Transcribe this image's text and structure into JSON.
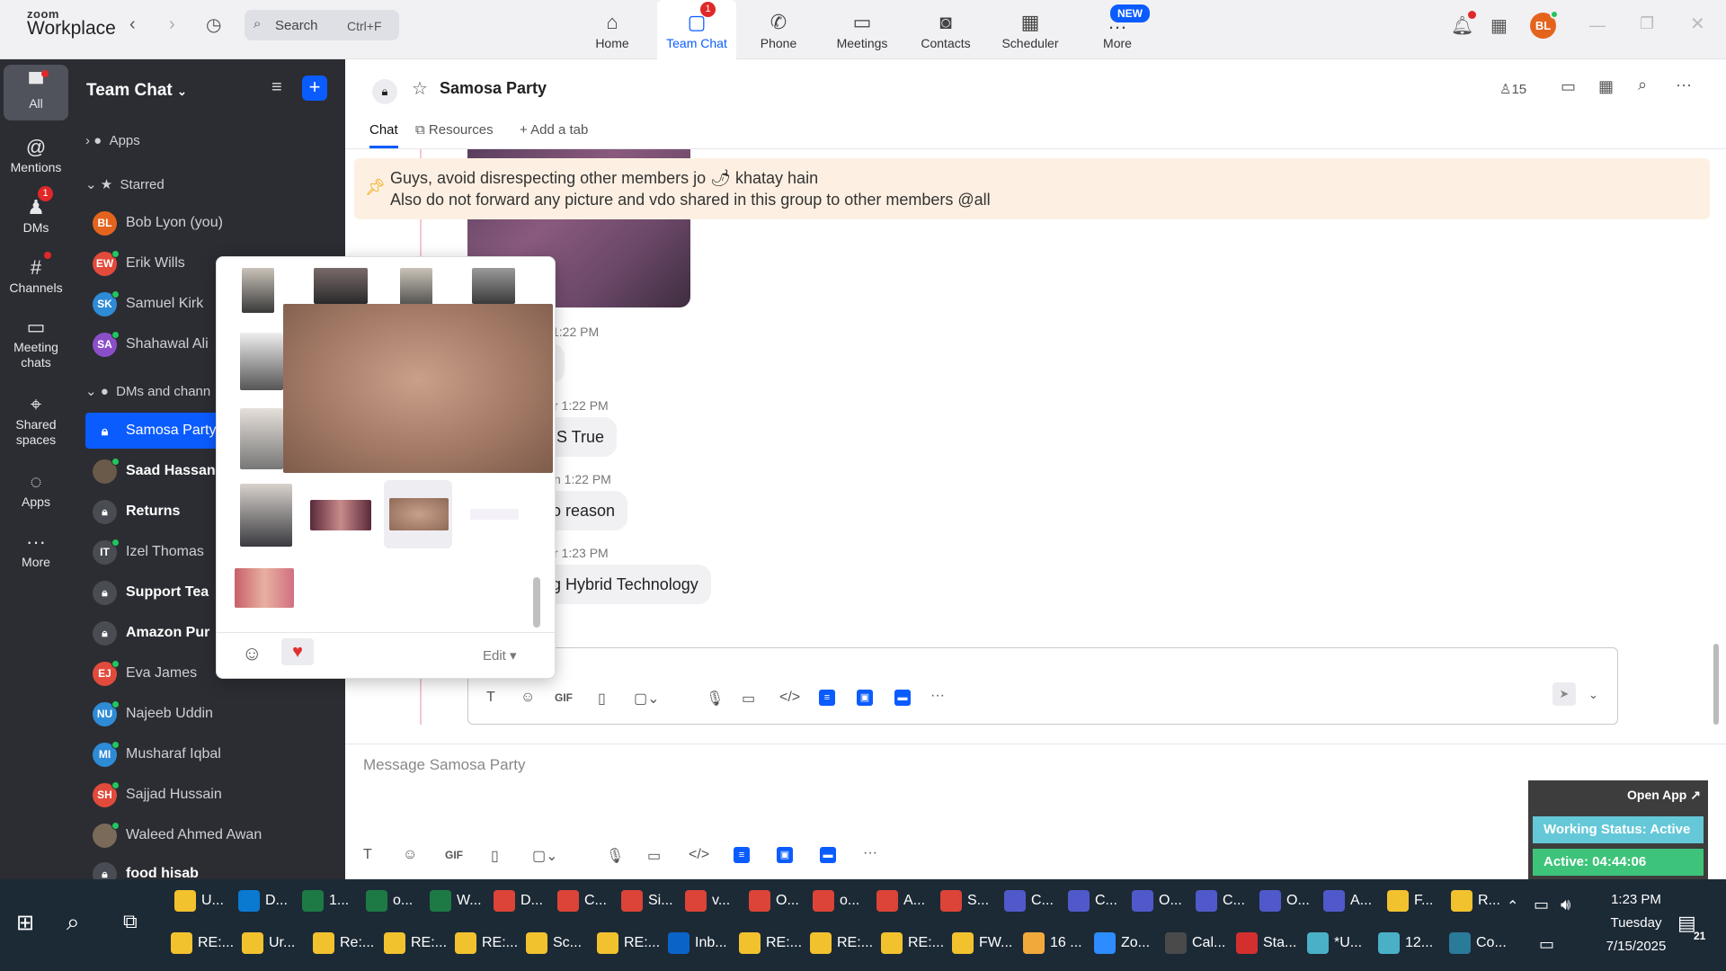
{
  "app": {
    "logo_top": "zoom",
    "logo_bottom": "Workplace"
  },
  "search": {
    "label": "Search",
    "shortcut": "Ctrl+F"
  },
  "nav": [
    {
      "label": "Home",
      "icon": "home-icon"
    },
    {
      "label": "Team Chat",
      "icon": "chat-icon",
      "badge": "1"
    },
    {
      "label": "Phone",
      "icon": "phone-icon"
    },
    {
      "label": "Meetings",
      "icon": "video-icon"
    },
    {
      "label": "Contacts",
      "icon": "contacts-icon"
    },
    {
      "label": "Scheduler",
      "icon": "calendar-icon"
    },
    {
      "label": "More",
      "icon": "more-icon",
      "badge": "NEW"
    }
  ],
  "user": {
    "initials": "BL"
  },
  "rail": [
    {
      "label": "All"
    },
    {
      "label": "Mentions"
    },
    {
      "label": "DMs",
      "badge": "1"
    },
    {
      "label": "Channels"
    },
    {
      "label": "Meeting chats"
    },
    {
      "label": "Shared spaces"
    },
    {
      "label": "Apps"
    },
    {
      "label": "More"
    }
  ],
  "sidebar": {
    "title": "Team Chat",
    "sections": {
      "apps": "Apps",
      "starred": "Starred",
      "dms": "DMs and chann"
    },
    "items": [
      {
        "initials": "BL",
        "name": "Bob Lyon (you)",
        "color": "#e4641e"
      },
      {
        "initials": "EW",
        "name": "Erik Wills",
        "color": "#e24a3b"
      },
      {
        "initials": "SK",
        "name": "Samuel Kirk",
        "color": "#2e8bd6"
      },
      {
        "initials": "SA",
        "name": "Shahawal Ali",
        "color": "#8a4fc8"
      },
      {
        "initials": "",
        "name": "Samosa Party",
        "color": "#0b5cff"
      },
      {
        "initials": "",
        "name": "Saad Hassan",
        "color": "#6a5a4a"
      },
      {
        "initials": "",
        "name": "Returns",
        "color": "#4a4c53"
      },
      {
        "initials": "IT",
        "name": "Izel Thomas",
        "color": "#4a4c53"
      },
      {
        "initials": "",
        "name": "Support Tea",
        "color": "#4a4c53"
      },
      {
        "initials": "",
        "name": "Amazon Pur",
        "color": "#4a4c53"
      },
      {
        "initials": "EJ",
        "name": "Eva James",
        "color": "#e24a3b"
      },
      {
        "initials": "NU",
        "name": "Najeeb Uddin",
        "color": "#2e8bd6"
      },
      {
        "initials": "MI",
        "name": "Musharaf Iqbal",
        "color": "#2e8bd6"
      },
      {
        "initials": "SH",
        "name": "Sajjad Hussain",
        "color": "#e24a3b"
      },
      {
        "initials": "",
        "name": "Waleed Ahmed Awan",
        "color": "#7a6a5a"
      },
      {
        "initials": "",
        "name": "food hisab",
        "color": "#4a4c53"
      }
    ]
  },
  "channel": {
    "name": "Samosa Party",
    "members": "15",
    "tabs": [
      "Chat",
      "Resources",
      "Add a tab"
    ],
    "pinned_line1": "Guys, avoid disrespecting other members jo 🌶 khatay hain",
    "pinned_line2": "Also do not forward any picture and vdo shared in this group to other members @all"
  },
  "messages": [
    {
      "time": "1:22 PM",
      "text": "a"
    },
    {
      "time": "r 1:22 PM",
      "text": "MS True"
    },
    {
      "time": "n 1:22 PM",
      "text": "no reason"
    },
    {
      "time": "r 1:23 PM",
      "text": "ng Hybrid Technology"
    }
  ],
  "composer": {
    "placeholder": "Message Samosa Party",
    "gif": "GIF"
  },
  "popup": {
    "edit": "Edit"
  },
  "status_widget": {
    "open_app": "Open App",
    "working": "Working Status: Active",
    "active": "Active: 04:44:06"
  },
  "taskbar": {
    "row1": [
      {
        "label": "U...",
        "color": "#f2c12e"
      },
      {
        "label": "D...",
        "color": "#0a7ad1"
      },
      {
        "label": "1...",
        "color": "#1d7a45"
      },
      {
        "label": "o...",
        "color": "#1d7a45"
      },
      {
        "label": "W...",
        "color": "#1d7a45"
      },
      {
        "label": "D...",
        "color": "#db4437"
      },
      {
        "label": "C...",
        "color": "#db4437"
      },
      {
        "label": "Si...",
        "color": "#db4437"
      },
      {
        "label": "v...",
        "color": "#db4437"
      },
      {
        "label": "O...",
        "color": "#db4437"
      },
      {
        "label": "o...",
        "color": "#db4437"
      },
      {
        "label": "A...",
        "color": "#db4437"
      },
      {
        "label": "S...",
        "color": "#db4437"
      },
      {
        "label": "C...",
        "color": "#5059c9"
      },
      {
        "label": "C...",
        "color": "#5059c9"
      },
      {
        "label": "O...",
        "color": "#5059c9"
      },
      {
        "label": "C...",
        "color": "#5059c9"
      },
      {
        "label": "O...",
        "color": "#5059c9"
      },
      {
        "label": "A...",
        "color": "#5059c9"
      },
      {
        "label": "F...",
        "color": "#f2c12e"
      },
      {
        "label": "R...",
        "color": "#f2c12e"
      }
    ],
    "row2": [
      {
        "label": "RE:...",
        "color": "#f2c12e"
      },
      {
        "label": "Ur...",
        "color": "#f2c12e"
      },
      {
        "label": "Re:...",
        "color": "#f2c12e"
      },
      {
        "label": "RE:...",
        "color": "#f2c12e"
      },
      {
        "label": "RE:...",
        "color": "#f2c12e"
      },
      {
        "label": "Sc...",
        "color": "#f2c12e"
      },
      {
        "label": "RE:...",
        "color": "#f2c12e"
      },
      {
        "label": "Inb...",
        "color": "#0a64c8"
      },
      {
        "label": "RE:...",
        "color": "#f2c12e"
      },
      {
        "label": "RE:...",
        "color": "#f2c12e"
      },
      {
        "label": "RE:...",
        "color": "#f2c12e"
      },
      {
        "label": "FW...",
        "color": "#f2c12e"
      },
      {
        "label": "16 ...",
        "color": "#f2a93b"
      },
      {
        "label": "Zo...",
        "color": "#2d8cff"
      },
      {
        "label": "Cal...",
        "color": "#4a4a4a"
      },
      {
        "label": "Sta...",
        "color": "#d32f2f"
      },
      {
        "label": "*U...",
        "color": "#4ab0c8"
      },
      {
        "label": "12...",
        "color": "#4ab0c8"
      },
      {
        "label": "Co...",
        "color": "#2a7a9a"
      }
    ],
    "time": "1:23 PM",
    "day": "Tuesday",
    "date": "7/15/2025",
    "notif_count": "21"
  }
}
